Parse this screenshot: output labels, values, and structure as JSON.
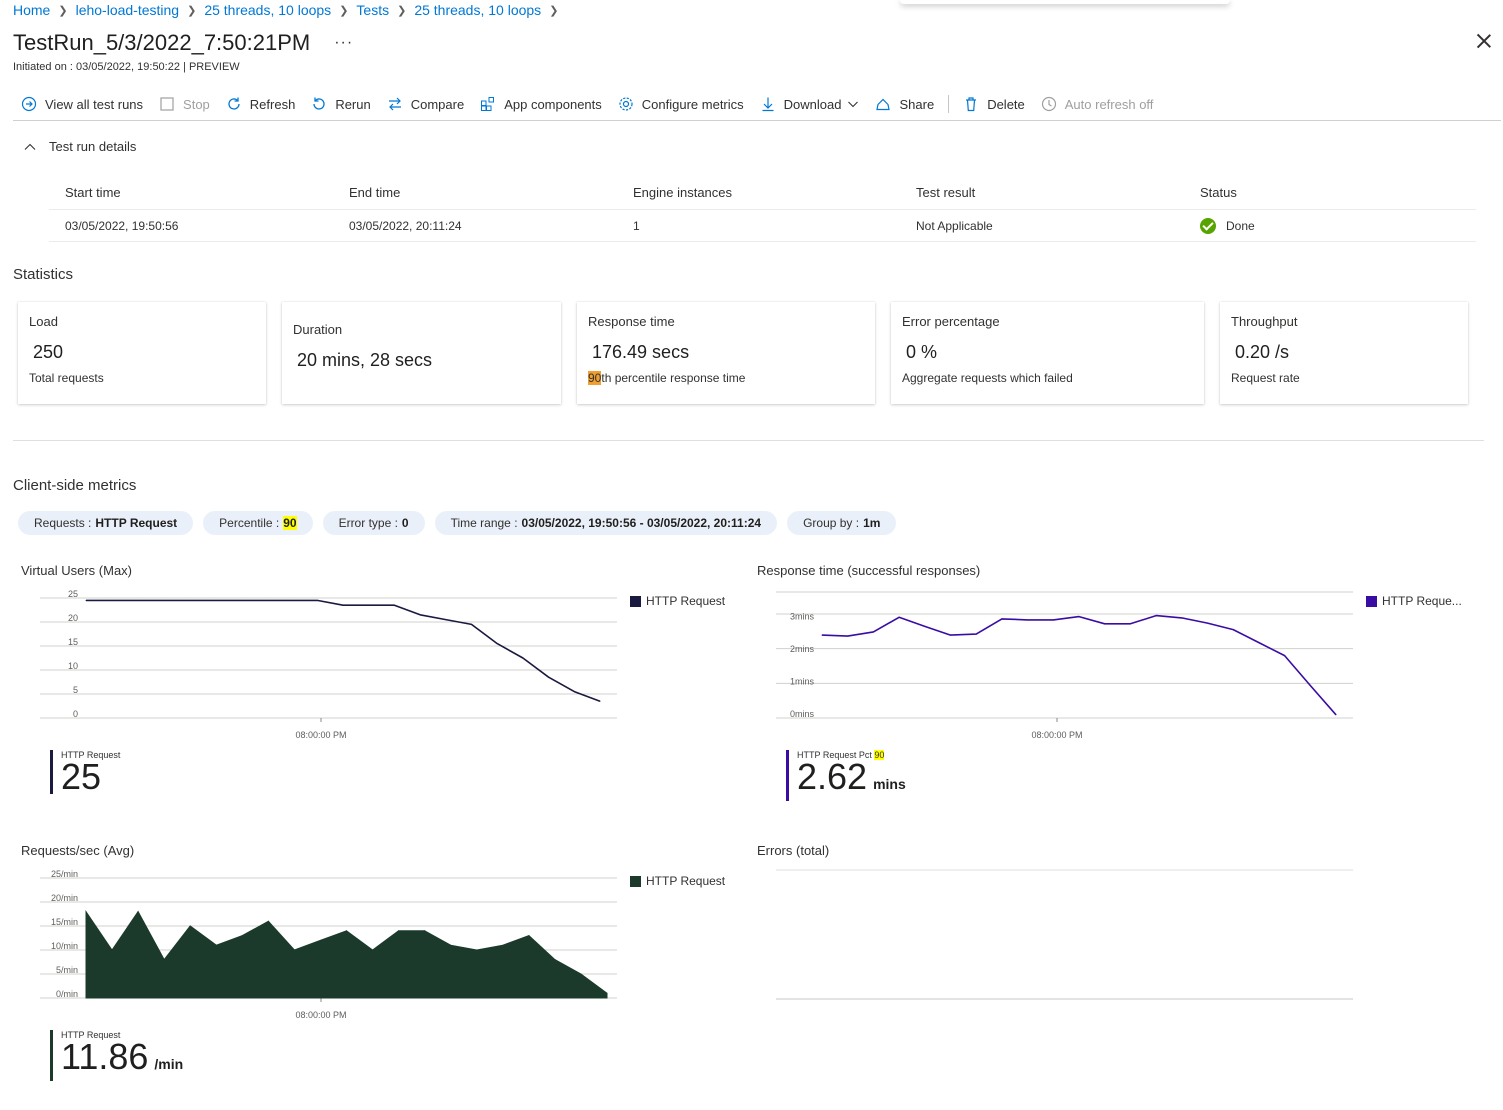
{
  "breadcrumb": [
    "Home",
    "leho-load-testing",
    "25 threads, 10 loops",
    "Tests",
    "25 threads, 10 loops"
  ],
  "title": "TestRun_5/3/2022_7:50:21PM",
  "more": "···",
  "subtitle": "Initiated on : 03/05/2022, 19:50:22 | PREVIEW",
  "toolbar": {
    "view_all": "View all test runs",
    "stop": "Stop",
    "refresh": "Refresh",
    "rerun": "Rerun",
    "compare": "Compare",
    "app_components": "App components",
    "configure_metrics": "Configure metrics",
    "download": "Download",
    "share": "Share",
    "delete": "Delete",
    "auto_refresh": "Auto refresh off"
  },
  "details": {
    "toggle": "Test run details",
    "headers": [
      "Start time",
      "End time",
      "Engine instances",
      "Test result",
      "Status"
    ],
    "row": [
      "03/05/2022, 19:50:56",
      "03/05/2022, 20:11:24",
      "1",
      "Not Applicable",
      "Done"
    ]
  },
  "statistics": {
    "heading": "Statistics",
    "cards": [
      {
        "label": "Load",
        "value": "250",
        "sub": "Total requests"
      },
      {
        "label": "Duration",
        "value": "20 mins, 28 secs",
        "sub": ""
      },
      {
        "label": "Response time",
        "value": "176.49 secs",
        "sub_hl": "90",
        "sub": "th percentile response time"
      },
      {
        "label": "Error percentage",
        "value": "0 %",
        "sub": "Aggregate requests which failed"
      },
      {
        "label": "Throughput",
        "value": "0.20 /s",
        "sub": "Request rate"
      }
    ]
  },
  "metrics": {
    "heading": "Client-side metrics",
    "pills": [
      {
        "key": "Requests :",
        "val": "HTTP Request"
      },
      {
        "key": "Percentile :",
        "val": "90"
      },
      {
        "key": "Error type :",
        "val": "0"
      },
      {
        "key": "Time range :",
        "val": "03/05/2022, 19:50:56 - 03/05/2022, 20:11:24"
      },
      {
        "key": "Group by :",
        "val": "1m"
      }
    ]
  },
  "charts": {
    "vu": {
      "title": "Virtual Users (Max)",
      "legend": "HTTP Request",
      "summary_label": "HTTP Request",
      "summary_value": "25",
      "summary_unit": ""
    },
    "rt": {
      "title": "Response time (successful responses)",
      "legend": "HTTP Reque...",
      "summary_label": "HTTP Request Pct",
      "summary_label_hl": "90",
      "summary_value": "2.62",
      "summary_unit": "mins"
    },
    "rps": {
      "title": "Requests/sec (Avg)",
      "legend": "HTTP Request",
      "summary_label": "HTTP Request",
      "summary_value": "11.86",
      "summary_unit": "/min"
    },
    "err": {
      "title": "Errors (total)"
    }
  },
  "chart_data": [
    {
      "type": "line",
      "title": "Virtual Users (Max)",
      "color": "#1a1a40",
      "xtick": "08:00:00 PM",
      "yticks": [
        "25",
        "20",
        "15",
        "10",
        "5",
        "0"
      ],
      "ylim": [
        0,
        25
      ],
      "series": [
        {
          "name": "HTTP Request",
          "values": [
            24.5,
            24.5,
            24.5,
            24.5,
            24.5,
            24.5,
            24.5,
            24.5,
            24.5,
            24.5,
            23.5,
            23.5,
            23.5,
            21.5,
            20.5,
            19.5,
            15.5,
            12.5,
            8.5,
            5.5,
            3.5
          ]
        }
      ]
    },
    {
      "type": "line",
      "title": "Response time (successful responses)",
      "color": "#3a0ca3",
      "xtick": "08:00:00 PM",
      "yticks": [
        "3mins",
        "2mins",
        "1mins",
        "0mins"
      ],
      "ylim": [
        0,
        3.2
      ],
      "series": [
        {
          "name": "HTTP Request",
          "values": [
            2.55,
            2.52,
            2.65,
            3.1,
            2.82,
            2.55,
            2.58,
            3.05,
            3.02,
            3.02,
            3.12,
            2.9,
            2.9,
            3.15,
            3.08,
            2.92,
            2.72,
            2.32,
            1.92,
            1.0,
            0.1
          ]
        }
      ]
    },
    {
      "type": "area",
      "title": "Requests/sec (Avg)",
      "color": "#1b3a2b",
      "xtick": "08:00:00 PM",
      "yticks": [
        "25/min",
        "20/min",
        "15/min",
        "10/min",
        "5/min",
        "0/min"
      ],
      "ylim": [
        0,
        25
      ],
      "series": [
        {
          "name": "HTTP Request",
          "values": [
            18,
            10,
            18,
            8,
            15,
            11,
            13,
            16,
            10,
            12,
            14,
            10,
            14,
            14,
            11,
            10,
            11,
            13,
            8,
            5,
            1
          ]
        }
      ]
    }
  ]
}
